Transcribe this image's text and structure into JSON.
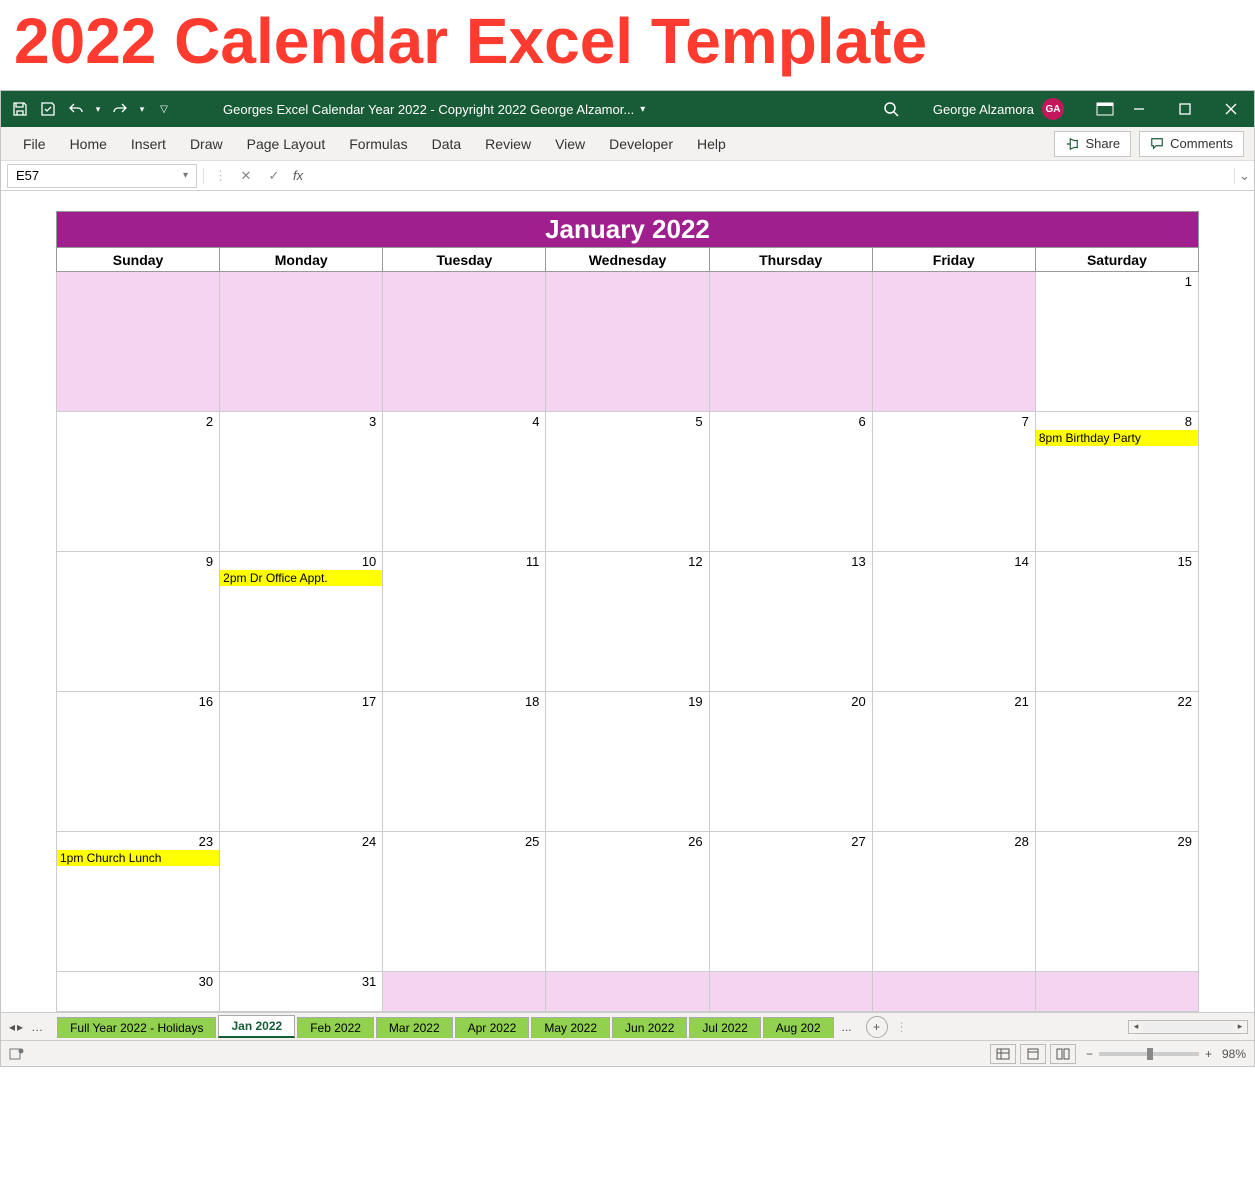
{
  "page_heading": "2022 Calendar Excel Template",
  "titlebar": {
    "document_title": "Georges Excel Calendar Year 2022 - Copyright 2022 George Alzamor...",
    "user_name": "George Alzamora",
    "user_initials": "GA"
  },
  "ribbon": {
    "tabs": [
      "File",
      "Home",
      "Insert",
      "Draw",
      "Page Layout",
      "Formulas",
      "Data",
      "Review",
      "View",
      "Developer",
      "Help"
    ],
    "share_label": "Share",
    "comments_label": "Comments"
  },
  "formula_bar": {
    "name_box_value": "E57",
    "fx_label": "fx",
    "formula_value": ""
  },
  "calendar": {
    "month_title": "January 2022",
    "weekdays": [
      "Sunday",
      "Monday",
      "Tuesday",
      "Wednesday",
      "Thursday",
      "Friday",
      "Saturday"
    ],
    "weeks": [
      {
        "cells": [
          {
            "date": "",
            "shaded": true
          },
          {
            "date": "",
            "shaded": true
          },
          {
            "date": "",
            "shaded": true
          },
          {
            "date": "",
            "shaded": true
          },
          {
            "date": "",
            "shaded": true
          },
          {
            "date": "",
            "shaded": true
          },
          {
            "date": "1"
          }
        ]
      },
      {
        "cells": [
          {
            "date": "2"
          },
          {
            "date": "3"
          },
          {
            "date": "4"
          },
          {
            "date": "5"
          },
          {
            "date": "6"
          },
          {
            "date": "7"
          },
          {
            "date": "8",
            "event": "8pm Birthday Party"
          }
        ]
      },
      {
        "cells": [
          {
            "date": "9"
          },
          {
            "date": "10",
            "event": "2pm Dr Office Appt."
          },
          {
            "date": "11"
          },
          {
            "date": "12"
          },
          {
            "date": "13"
          },
          {
            "date": "14"
          },
          {
            "date": "15"
          }
        ]
      },
      {
        "cells": [
          {
            "date": "16"
          },
          {
            "date": "17"
          },
          {
            "date": "18"
          },
          {
            "date": "19"
          },
          {
            "date": "20"
          },
          {
            "date": "21"
          },
          {
            "date": "22"
          }
        ]
      },
      {
        "cells": [
          {
            "date": "23",
            "event": "1pm Church Lunch"
          },
          {
            "date": "24"
          },
          {
            "date": "25"
          },
          {
            "date": "26"
          },
          {
            "date": "27"
          },
          {
            "date": "28"
          },
          {
            "date": "29"
          }
        ]
      },
      {
        "cells": [
          {
            "date": "30"
          },
          {
            "date": "31"
          },
          {
            "date": "",
            "shaded": true
          },
          {
            "date": "",
            "shaded": true
          },
          {
            "date": "",
            "shaded": true
          },
          {
            "date": "",
            "shaded": true
          },
          {
            "date": "",
            "shaded": true
          }
        ]
      }
    ]
  },
  "sheet_tabs": {
    "tabs": [
      {
        "label": "Full Year 2022 - Holidays",
        "active": false
      },
      {
        "label": "Jan 2022",
        "active": true
      },
      {
        "label": "Feb 2022",
        "active": false
      },
      {
        "label": "Mar 2022",
        "active": false
      },
      {
        "label": "Apr 2022",
        "active": false
      },
      {
        "label": "May 2022",
        "active": false
      },
      {
        "label": "Jun 2022",
        "active": false
      },
      {
        "label": "Jul 2022",
        "active": false
      },
      {
        "label": "Aug 202",
        "active": false
      }
    ],
    "more_indicator": "..."
  },
  "status_bar": {
    "zoom_label": "98%"
  }
}
